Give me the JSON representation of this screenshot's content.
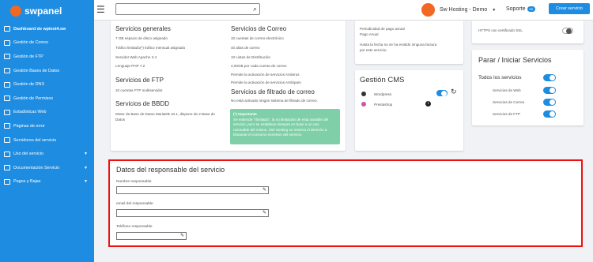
{
  "brand": "swpanel",
  "sidebar": {
    "items": [
      {
        "label": "Dashboard de wptest4.sw"
      },
      {
        "label": "Gestión de Correo"
      },
      {
        "label": "Gestión de FTP"
      },
      {
        "label": "Gestión Bases de Datos"
      },
      {
        "label": "Gestión de DNS"
      },
      {
        "label": "Gestión de Permisos"
      },
      {
        "label": "Estadísticas Web"
      },
      {
        "label": "Páginas de error"
      },
      {
        "label": "Servidores del servicio"
      },
      {
        "label": "Uso del servicio"
      },
      {
        "label": "Documentación Servicio"
      },
      {
        "label": "Pagos y Bajas"
      }
    ]
  },
  "topbar": {
    "search_placeholder": "",
    "account": "Sw Hosting - Demo",
    "support": "Soporte",
    "support_badge": "99",
    "new_service": "Crear servicio"
  },
  "generales": {
    "title": "Servicios generales",
    "disk": "7 GB espacio de disco asignado",
    "traffic": "Tráfico limitado(*) tráfico mensual asignado",
    "server": "Servidor Web Apache 2.4",
    "language": "Lenguaje PHP 7.2"
  },
  "ftp": {
    "title": "Servicios de FTP",
    "accounts": "10 cuentas FTP multiservidor"
  },
  "bbdd": {
    "title": "Servicios de BBDD",
    "text_line1": "Motor de Base de Datos MariaDB 10.1, dispone de 2 Base de",
    "text_line2": "Datos"
  },
  "correo": {
    "title": "Servicios de Correo",
    "accounts": "10 cuentas de correo electrónico",
    "aliases": "40 alias de correo",
    "lists": "10 Listas de Distribución",
    "quota": "4,00GB por cada cuenta de correo",
    "antivirus": "Permite la activación de servicios Antivirus",
    "antispam": "Permite la activación de servicios AntiSpam"
  },
  "filtrado": {
    "title": "Servicios de filtrado de correo",
    "text": "No está activado ningún sistema de filtrado de correo."
  },
  "important": {
    "title": "(*) Importante",
    "lines": [
      "Se entiende \"Ilimitado\", la no limitación de esta variable del",
      "servicio, pero se establece siempre en base a un uso",
      "razonable del mismo. SW Hosting se reserva el derecho a",
      "bloquear el consumo excesivo del servicio."
    ]
  },
  "pago": {
    "period_label": "Periodicidad de pago actual",
    "period_value": "Pago Anual",
    "note_line1": "Hasta la fecha no se ha emitido ninguna factura",
    "note_line2": "por este servicio."
  },
  "cms": {
    "title": "Gestión CMS",
    "items": [
      {
        "label": "Wordpress"
      },
      {
        "label": "Prestashop"
      }
    ]
  },
  "ssl": {
    "label": "HTTPS con certificado SSL"
  },
  "parar": {
    "title": "Parar / Iniciar Servicios",
    "all": "Todos los servicios",
    "web": "Servicios de Web",
    "correo": "Servicios de Correo",
    "ftp": "Servicios de FTP"
  },
  "responsable": {
    "title": "Datos del responsable del servicio",
    "name_label": "Nombre responsable",
    "email_label": "email del responsable",
    "phone_label": "Teléfono responsable"
  },
  "colors": {
    "primary": "#1e8ce0",
    "accent": "#f26722",
    "note": "#7fd0a8",
    "highlight": "#e11111"
  }
}
